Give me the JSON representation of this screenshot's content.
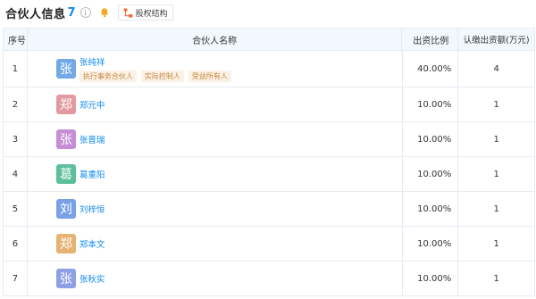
{
  "header": {
    "title": "合伙人信息",
    "count": "7",
    "info_symbol": "i",
    "equity_label": "股权结构"
  },
  "table": {
    "columns": [
      "序号",
      "合伙人名称",
      "出资比例",
      "认缴出资额(万元)"
    ],
    "rows": [
      {
        "index": "1",
        "avatar_char": "张",
        "avatar_color": "#73a9e5",
        "name": "张纯祥",
        "tags": [
          "执行事务合伙人",
          "实际控制人",
          "受益所有人"
        ],
        "ratio": "40.00%",
        "amount": "4"
      },
      {
        "index": "2",
        "avatar_char": "郑",
        "avatar_color": "#e3999f",
        "name": "郑元中",
        "tags": [],
        "ratio": "10.00%",
        "amount": "1"
      },
      {
        "index": "3",
        "avatar_char": "张",
        "avatar_color": "#c68ed4",
        "name": "张晋瑞",
        "tags": [],
        "ratio": "10.00%",
        "amount": "1"
      },
      {
        "index": "4",
        "avatar_char": "葛",
        "avatar_color": "#5dbf9a",
        "name": "葛重阳",
        "tags": [],
        "ratio": "10.00%",
        "amount": "1"
      },
      {
        "index": "5",
        "avatar_char": "刘",
        "avatar_color": "#7aa1e6",
        "name": "刘梓恒",
        "tags": [],
        "ratio": "10.00%",
        "amount": "1"
      },
      {
        "index": "6",
        "avatar_char": "郑",
        "avatar_color": "#e6b373",
        "name": "郑本文",
        "tags": [],
        "ratio": "10.00%",
        "amount": "1"
      },
      {
        "index": "7",
        "avatar_char": "张",
        "avatar_color": "#8fa0e6",
        "name": "张秋实",
        "tags": [],
        "ratio": "10.00%",
        "amount": "1"
      }
    ]
  },
  "colors": {
    "link": "#128bed",
    "header_bg": "#f2f8fe",
    "tag_text": "#c5883d",
    "tag_bg": "#fbf1e6",
    "bell": "#f5a623",
    "equity_icon": "#f06c3b"
  }
}
